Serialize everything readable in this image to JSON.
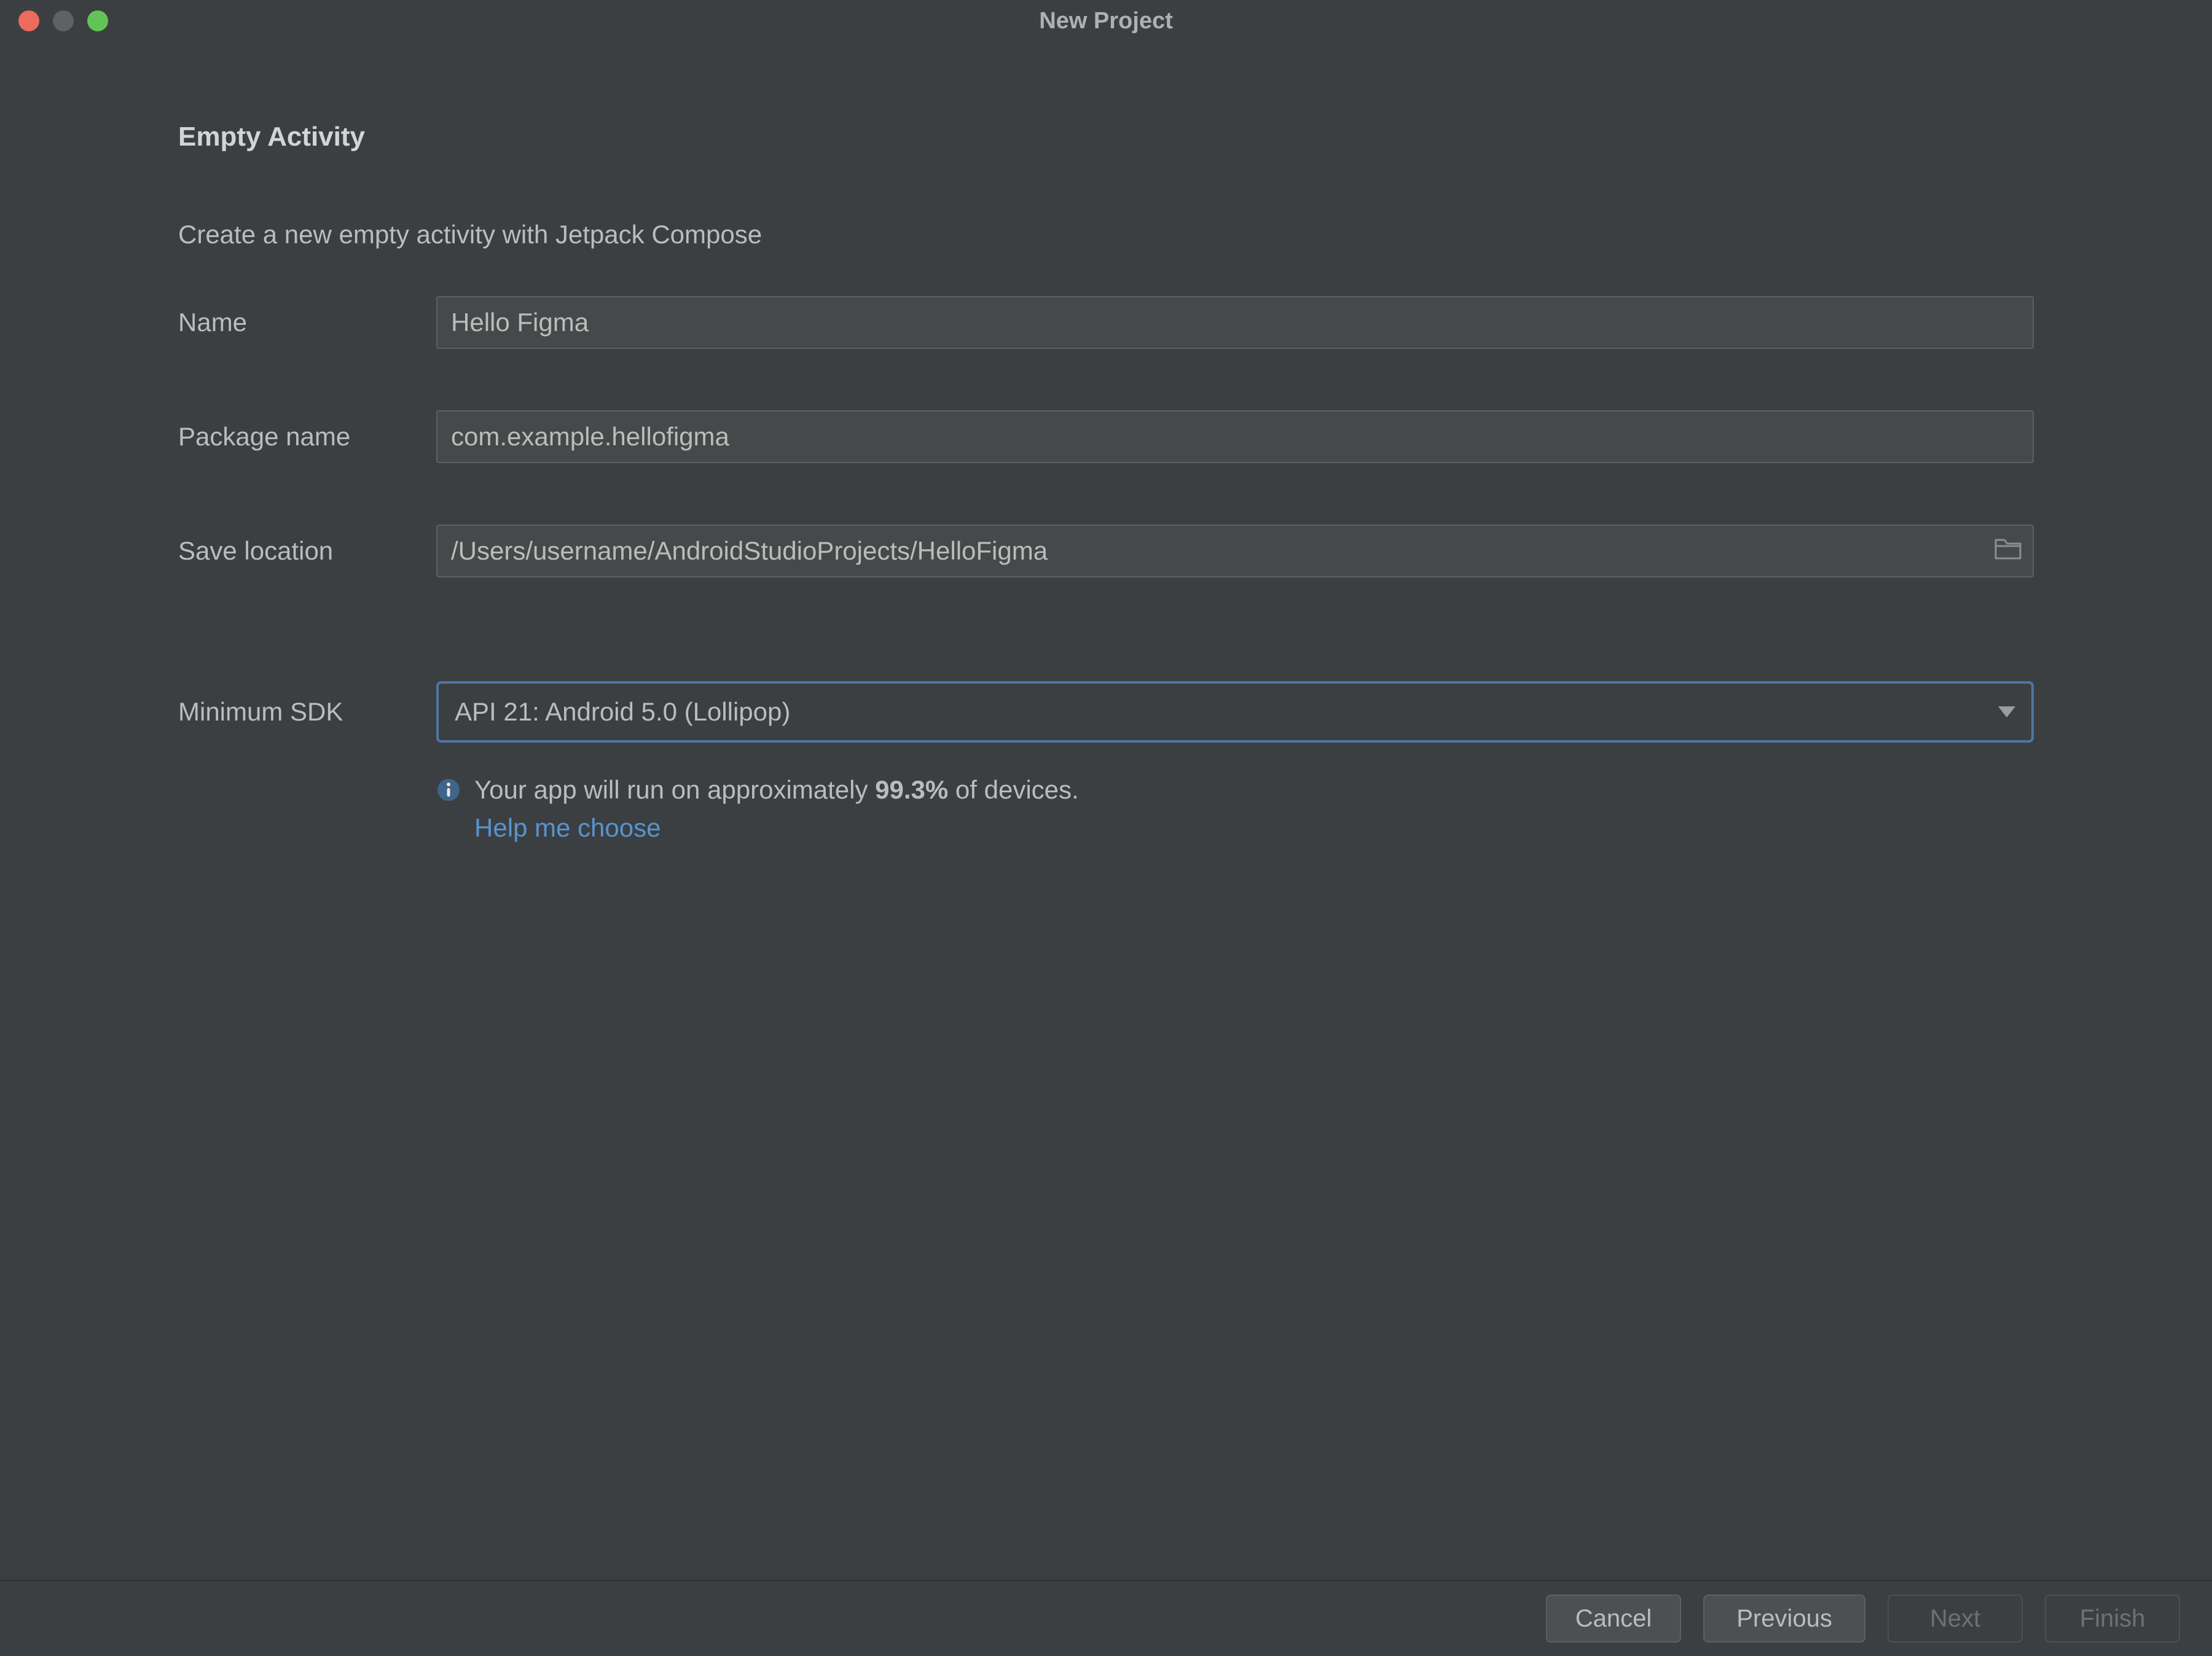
{
  "window": {
    "title": "New Project"
  },
  "header": {
    "heading": "Empty Activity",
    "subheading": "Create a new empty activity with Jetpack Compose"
  },
  "form": {
    "name_label": "Name",
    "name_value": "Hello Figma",
    "package_label": "Package name",
    "package_value": "com.example.hellofigma",
    "location_label": "Save location",
    "location_value": "/Users/username/AndroidStudioProjects/HelloFigma",
    "sdk_label": "Minimum SDK",
    "sdk_value": "API 21: Android 5.0 (Lollipop)"
  },
  "info": {
    "prefix": "Your app will run on approximately ",
    "percent": "99.3%",
    "suffix": " of devices.",
    "help": "Help me choose"
  },
  "footer": {
    "cancel": "Cancel",
    "previous": "Previous",
    "next": "Next",
    "finish": "Finish"
  }
}
